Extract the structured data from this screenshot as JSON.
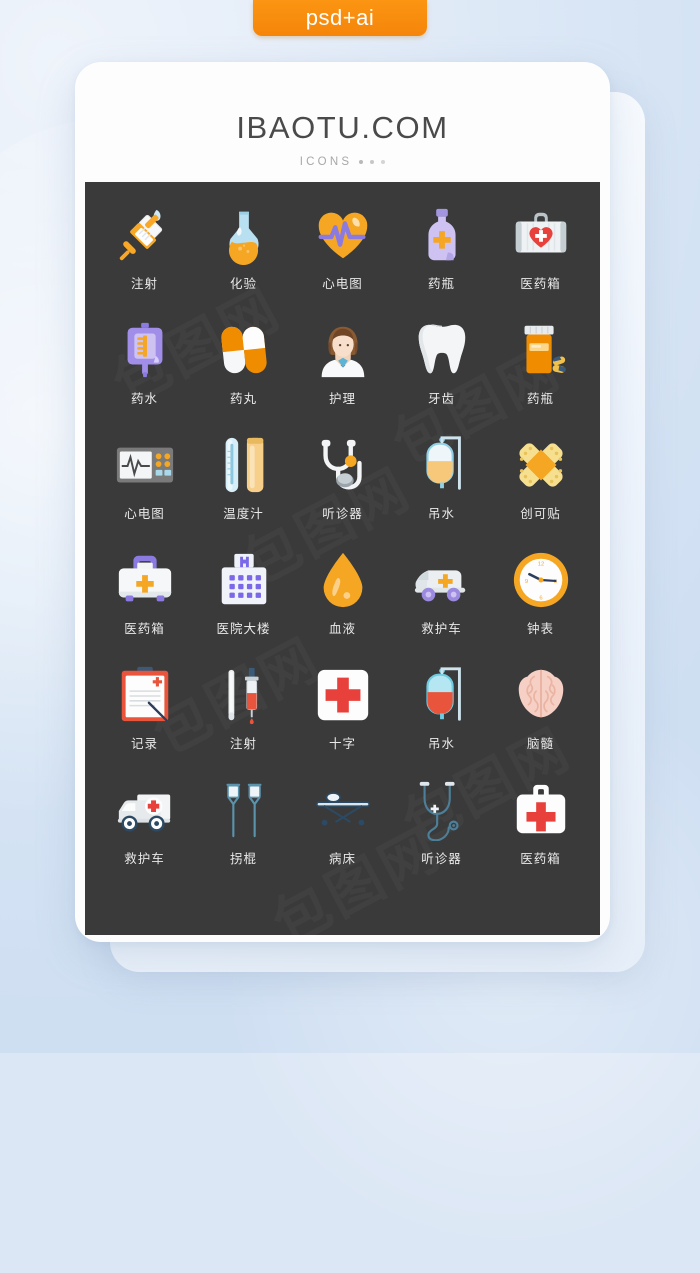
{
  "tag": {
    "label": "psd+ai",
    "color": "#f5860a"
  },
  "card": {
    "brand": "IBAOTU.COM",
    "subtitle": "ICONS",
    "panel_bg": "#3a3a3a",
    "label_color": "#e9e9e9",
    "watermark": "包图网"
  },
  "icons": [
    {
      "name": "syringe",
      "label": "注射",
      "colors": [
        "#f5a623",
        "#f2f6f8",
        "#b8e2ef"
      ]
    },
    {
      "name": "flask",
      "label": "化验",
      "colors": [
        "#a8d8ea",
        "#f5a623",
        "#d9eef7"
      ]
    },
    {
      "name": "heart-ecg",
      "label": "心电图",
      "colors": [
        "#f5a623",
        "#8b7ae0"
      ]
    },
    {
      "name": "medicine-bottle",
      "label": "药瓶",
      "colors": [
        "#c5b8ef",
        "#f5a623"
      ]
    },
    {
      "name": "first-aid-case",
      "label": "医药箱",
      "colors": [
        "#e8eef0",
        "#e8413c",
        "#ffffff"
      ]
    },
    {
      "name": "iv-bag-purple",
      "label": "药水",
      "colors": [
        "#8b7ae0",
        "#f5a623",
        "#c5b8ef"
      ]
    },
    {
      "name": "pills-capsule",
      "label": "药丸",
      "colors": [
        "#f08c00",
        "#ffffff"
      ]
    },
    {
      "name": "nurse",
      "label": "护理",
      "colors": [
        "#7a4a2a",
        "#f6f6f6",
        "#5bb4d6"
      ]
    },
    {
      "name": "tooth",
      "label": "牙齿",
      "colors": [
        "#f2f2f2",
        "#e0e0e0"
      ]
    },
    {
      "name": "pill-bottle",
      "label": "药瓶",
      "colors": [
        "#f08c00",
        "#e8e8e8",
        "#3b5a78"
      ]
    },
    {
      "name": "ecg-monitor",
      "label": "心电图",
      "colors": [
        "#6e6e6e",
        "#f2f2f2",
        "#f5a623",
        "#a8d8ea"
      ]
    },
    {
      "name": "thermometer",
      "label": "温度汁",
      "colors": [
        "#cfeaf5",
        "#f5c069"
      ]
    },
    {
      "name": "stethoscope",
      "label": "听诊器",
      "colors": [
        "#f2f2f2",
        "#f5a623",
        "#8e8e8e"
      ]
    },
    {
      "name": "iv-drip-orange",
      "label": "吊水",
      "colors": [
        "#eef4f7",
        "#f5b44a",
        "#a8d8ea"
      ]
    },
    {
      "name": "bandage-cross",
      "label": "创可贴",
      "colors": [
        "#f5dd86",
        "#f5a623"
      ]
    },
    {
      "name": "first-aid-kit",
      "label": "医药箱",
      "colors": [
        "#8b7ae0",
        "#f5f7f8",
        "#f5a623"
      ]
    },
    {
      "name": "hospital",
      "label": "医院大楼",
      "colors": [
        "#eef2fa",
        "#7b68e8"
      ]
    },
    {
      "name": "blood-drop",
      "label": "血液",
      "colors": [
        "#f5a623",
        "#f7b84e"
      ]
    },
    {
      "name": "ambulance",
      "label": "救护车",
      "colors": [
        "#eceff1",
        "#f5a623",
        "#8b7ae0"
      ]
    },
    {
      "name": "clock",
      "label": "钟表",
      "colors": [
        "#f5a623",
        "#fdfdfd",
        "#2c3e5c"
      ]
    },
    {
      "name": "clipboard",
      "label": "记录",
      "colors": [
        "#e8553c",
        "#fdfdfd",
        "#3b5a78"
      ]
    },
    {
      "name": "syringe-thermo",
      "label": "注射",
      "colors": [
        "#e8e8e8",
        "#e8553c",
        "#3b5a78"
      ]
    },
    {
      "name": "red-cross",
      "label": "十字",
      "colors": [
        "#fdfdfd",
        "#e8413c"
      ]
    },
    {
      "name": "iv-drip-red",
      "label": "吊水",
      "colors": [
        "#a8e3ef",
        "#e8553c"
      ]
    },
    {
      "name": "brain",
      "label": "脑髓",
      "colors": [
        "#f5cfc4",
        "#e8b5a6"
      ]
    },
    {
      "name": "ambulance-side",
      "label": "救护车",
      "colors": [
        "#f2f4f5",
        "#e8413c",
        "#2c4a63"
      ]
    },
    {
      "name": "crutches",
      "label": "拐棍",
      "colors": [
        "#e8eef0",
        "#3b6e8c"
      ]
    },
    {
      "name": "hospital-bed",
      "label": "病床",
      "colors": [
        "#e8eef0",
        "#2c4a63"
      ]
    },
    {
      "name": "stethoscope-2",
      "label": "听诊器",
      "colors": [
        "#e8eef0",
        "#3b6e8c"
      ]
    },
    {
      "name": "medical-case",
      "label": "医药箱",
      "colors": [
        "#fdfdfd",
        "#e8413c"
      ]
    }
  ]
}
